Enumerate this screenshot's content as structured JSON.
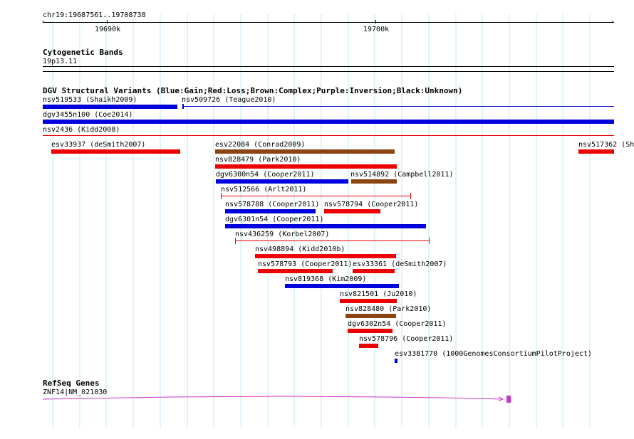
{
  "ruler": {
    "range_label": "chr19:19687561..19708738",
    "tick_labels": [
      "19690k",
      "19700k"
    ]
  },
  "cytoband": {
    "title": "Cytogenetic Bands",
    "band": "19p13.11"
  },
  "dgv": {
    "title": "DGV Structural Variants (Blue:Gain;Red:Loss;Brown:Complex;Purple:Inversion;Black:Unknown)",
    "colors": {
      "gain": "#0000dd",
      "loss": "#ee0000",
      "complex": "#8b4513",
      "unknown": "#000000"
    },
    "features": [
      {
        "label": "nsv519533 (Shaikh2009)",
        "color": "blue"
      },
      {
        "label": "nsv509726 (Teague2010)",
        "color": "blue"
      },
      {
        "label": "dgv3455n100 (Coe2014)",
        "color": "blue"
      },
      {
        "label": "nsv2436 (Kidd2008)",
        "color": "red"
      },
      {
        "label": "esv33937 (deSmith2007)",
        "color": "red"
      },
      {
        "label": "esv22084 (Conrad2009)",
        "color": "brown"
      },
      {
        "label": "nsv517362 (Sh",
        "color": "red"
      },
      {
        "label": "nsv828479 (Park2010)",
        "color": "red"
      },
      {
        "label": "dgv6300n54 (Cooper2011)",
        "color": "blue"
      },
      {
        "label": "nsv514892 (Campbell2011)",
        "color": "brown"
      },
      {
        "label": "nsv512566 (Arlt2011)",
        "color": "red"
      },
      {
        "label": "nsv578788 (Cooper2011)",
        "color": "blue"
      },
      {
        "label": "nsv578794 (Cooper2011)",
        "color": "red"
      },
      {
        "label": "dgv6301n54 (Cooper2011)",
        "color": "blue"
      },
      {
        "label": "nsv436259 (Korbel2007)",
        "color": "red"
      },
      {
        "label": "nsv498894 (Kidd2010b)",
        "color": "red"
      },
      {
        "label": "nsv578793 (Cooper2011)",
        "color": "red"
      },
      {
        "label": "esv33361 (deSmith2007)",
        "color": "red"
      },
      {
        "label": "nsv819368 (Kim2009)",
        "color": "blue"
      },
      {
        "label": "nsv821501 (Ju2010)",
        "color": "red"
      },
      {
        "label": "nsv828480 (Park2010)",
        "color": "brown"
      },
      {
        "label": "dgv6302n54 (Cooper2011)",
        "color": "red"
      },
      {
        "label": "nsv578796 (Cooper2011)",
        "color": "red"
      },
      {
        "label": "esv3381770 (1000GenomesConsortiumPilotProject)",
        "color": "blue"
      }
    ]
  },
  "refseq": {
    "title": "RefSeq Genes",
    "gene_label": "ZNF14|NM_021030",
    "color": "#cc33cc"
  }
}
